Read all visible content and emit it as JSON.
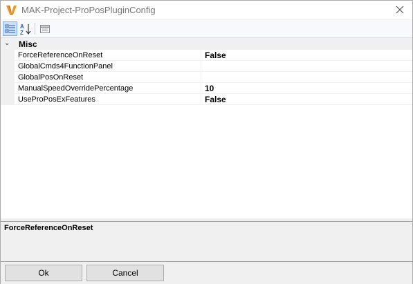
{
  "window": {
    "title": "MAK-Project-ProPosPluginConfig",
    "close_icon": "close-icon",
    "app_icon": "vi-logo-icon"
  },
  "toolbar": {
    "categorized_icon": "categorized-view-icon",
    "alphabetical_icon": "sort-alphabetical-icon",
    "property_pages_icon": "property-pages-icon"
  },
  "grid": {
    "category": {
      "label": "Misc",
      "toggle": "⌄"
    },
    "properties": [
      {
        "name": "ForceReferenceOnReset",
        "value": "False"
      },
      {
        "name": "GlobalCmds4FunctionPanel",
        "value": ""
      },
      {
        "name": "GlobalPosOnReset",
        "value": ""
      },
      {
        "name": "ManualSpeedOverridePercentage",
        "value": "10"
      },
      {
        "name": "UseProPosExFeatures",
        "value": "False"
      }
    ]
  },
  "description": {
    "title": "ForceReferenceOnReset"
  },
  "buttons": {
    "ok_label": "Ok",
    "cancel_label": "Cancel"
  },
  "colors": {
    "logo_orange": "#e8962a",
    "active_button_bg": "#c9e0f7"
  }
}
